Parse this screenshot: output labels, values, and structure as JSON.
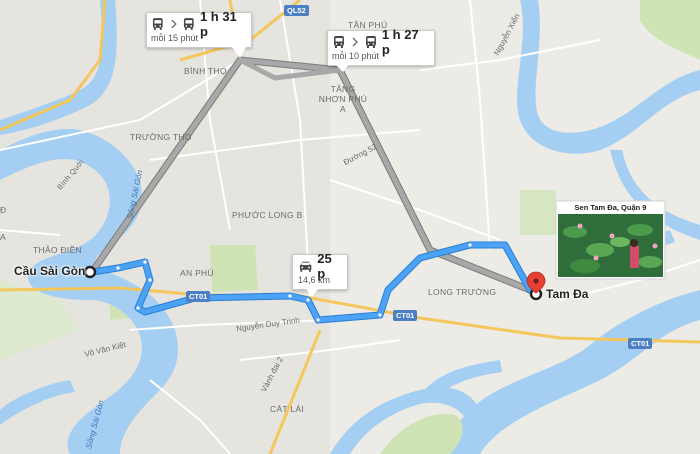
{
  "endpoints": {
    "origin": "Cầu Sài Gòn",
    "destination": "Tam Đa"
  },
  "route_callouts": [
    {
      "id": "transit_1",
      "duration": "1 h 31 p",
      "subtitle": "mỗi 15 phút",
      "mode_icons": [
        "bus-icon",
        "chevron-right-icon",
        "bus-icon"
      ]
    },
    {
      "id": "transit_2",
      "duration": "1 h 27 p",
      "subtitle": "mỗi 10 phút",
      "mode_icons": [
        "bus-icon",
        "chevron-right-icon",
        "bus-icon"
      ]
    },
    {
      "id": "car",
      "duration": "25 p",
      "subtitle": "14,6 km",
      "mode_icons": [
        "car-icon"
      ]
    }
  ],
  "place_photo": {
    "caption": "Sen Tam Đa, Quận 9"
  },
  "area_labels": {
    "tan_phu": "TÂN PHÚ",
    "binh_tho": "BÌNH THỌ",
    "tang_nhon_phu_a": "TĂNG NHƠN PHÚ A",
    "truong_tho": "TRƯỜNG THỌ",
    "binh_quoi": "Bình Quới",
    "phuoc_long_b": "PHƯỚC LONG B",
    "thao_dien": "THẢO ĐIỀN",
    "an_phu": "AN PHÚ",
    "long_truong": "LONG TRƯỜNG",
    "cat_lai": "CÁT LÁI",
    "d_edge": "Đ",
    "a_edge": "A"
  },
  "road_labels": {
    "duong_52": "Đường 52",
    "nguyen_duy_trinh": "Nguyễn Duy Trinh",
    "vo_van_kiet": "Võ Văn Kiệt",
    "vanh_dai_2": "Vành đai 2",
    "nguyen_xien": "Nguyễn Xiển"
  },
  "river_labels": {
    "song_sai_gon_north": "Sông Sài Gòn",
    "song_sai_gon_south": "Sông Sài Gòn"
  },
  "shields": {
    "ql52": "QL52",
    "ct01_a": "CT01",
    "ct01_b": "CT01",
    "ct01_c": "CT01"
  },
  "colors": {
    "route_primary": "#4ca3f5",
    "route_primary_outline": "#2a7fd4",
    "route_alt": "#9e9e9e",
    "water": "#a5cff2",
    "land": "#ecebe6",
    "park": "#cfe3b5",
    "highway": "#f4c75a",
    "destination_pin": "#e54035"
  }
}
